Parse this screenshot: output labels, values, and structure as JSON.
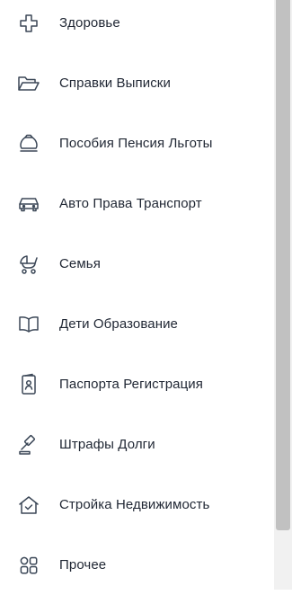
{
  "menu": {
    "items": [
      {
        "label": "Здоровье",
        "icon": "medical-cross-icon"
      },
      {
        "label": "Справки Выписки",
        "icon": "folder-icon"
      },
      {
        "label": "Пособия Пенсия Льготы",
        "icon": "money-bag-icon"
      },
      {
        "label": "Авто Права Транспорт",
        "icon": "car-icon"
      },
      {
        "label": "Семья",
        "icon": "baby-stroller-icon"
      },
      {
        "label": "Дети Образование",
        "icon": "open-book-icon"
      },
      {
        "label": "Паспорта Регистрация",
        "icon": "passport-icon"
      },
      {
        "label": "Штрафы Долги",
        "icon": "gavel-icon"
      },
      {
        "label": "Стройка Недвижимость",
        "icon": "house-check-icon"
      },
      {
        "label": "Прочее",
        "icon": "apps-grid-icon"
      }
    ]
  },
  "colors": {
    "text": "#1f2633",
    "icon": "#3b4757",
    "background": "#ffffff",
    "scrollbar_track": "#f1f1f1",
    "scrollbar_thumb": "#c1c1c1"
  }
}
